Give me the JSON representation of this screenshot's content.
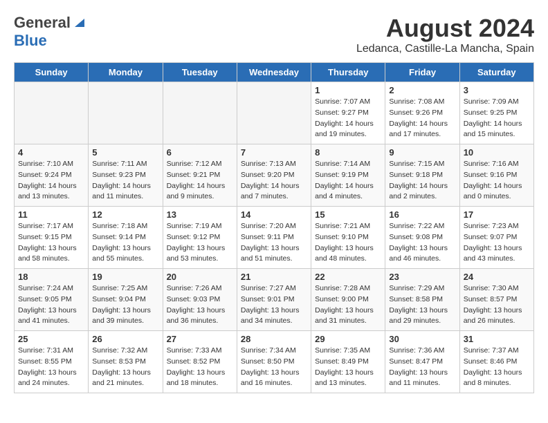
{
  "header": {
    "logo_general": "General",
    "logo_blue": "Blue",
    "month_title": "August 2024",
    "location": "Ledanca, Castille-La Mancha, Spain"
  },
  "days_of_week": [
    "Sunday",
    "Monday",
    "Tuesday",
    "Wednesday",
    "Thursday",
    "Friday",
    "Saturday"
  ],
  "weeks": [
    [
      {
        "day": "",
        "info": ""
      },
      {
        "day": "",
        "info": ""
      },
      {
        "day": "",
        "info": ""
      },
      {
        "day": "",
        "info": ""
      },
      {
        "day": "1",
        "info": "Sunrise: 7:07 AM\nSunset: 9:27 PM\nDaylight: 14 hours\nand 19 minutes."
      },
      {
        "day": "2",
        "info": "Sunrise: 7:08 AM\nSunset: 9:26 PM\nDaylight: 14 hours\nand 17 minutes."
      },
      {
        "day": "3",
        "info": "Sunrise: 7:09 AM\nSunset: 9:25 PM\nDaylight: 14 hours\nand 15 minutes."
      }
    ],
    [
      {
        "day": "4",
        "info": "Sunrise: 7:10 AM\nSunset: 9:24 PM\nDaylight: 14 hours\nand 13 minutes."
      },
      {
        "day": "5",
        "info": "Sunrise: 7:11 AM\nSunset: 9:23 PM\nDaylight: 14 hours\nand 11 minutes."
      },
      {
        "day": "6",
        "info": "Sunrise: 7:12 AM\nSunset: 9:21 PM\nDaylight: 14 hours\nand 9 minutes."
      },
      {
        "day": "7",
        "info": "Sunrise: 7:13 AM\nSunset: 9:20 PM\nDaylight: 14 hours\nand 7 minutes."
      },
      {
        "day": "8",
        "info": "Sunrise: 7:14 AM\nSunset: 9:19 PM\nDaylight: 14 hours\nand 4 minutes."
      },
      {
        "day": "9",
        "info": "Sunrise: 7:15 AM\nSunset: 9:18 PM\nDaylight: 14 hours\nand 2 minutes."
      },
      {
        "day": "10",
        "info": "Sunrise: 7:16 AM\nSunset: 9:16 PM\nDaylight: 14 hours\nand 0 minutes."
      }
    ],
    [
      {
        "day": "11",
        "info": "Sunrise: 7:17 AM\nSunset: 9:15 PM\nDaylight: 13 hours\nand 58 minutes."
      },
      {
        "day": "12",
        "info": "Sunrise: 7:18 AM\nSunset: 9:14 PM\nDaylight: 13 hours\nand 55 minutes."
      },
      {
        "day": "13",
        "info": "Sunrise: 7:19 AM\nSunset: 9:12 PM\nDaylight: 13 hours\nand 53 minutes."
      },
      {
        "day": "14",
        "info": "Sunrise: 7:20 AM\nSunset: 9:11 PM\nDaylight: 13 hours\nand 51 minutes."
      },
      {
        "day": "15",
        "info": "Sunrise: 7:21 AM\nSunset: 9:10 PM\nDaylight: 13 hours\nand 48 minutes."
      },
      {
        "day": "16",
        "info": "Sunrise: 7:22 AM\nSunset: 9:08 PM\nDaylight: 13 hours\nand 46 minutes."
      },
      {
        "day": "17",
        "info": "Sunrise: 7:23 AM\nSunset: 9:07 PM\nDaylight: 13 hours\nand 43 minutes."
      }
    ],
    [
      {
        "day": "18",
        "info": "Sunrise: 7:24 AM\nSunset: 9:05 PM\nDaylight: 13 hours\nand 41 minutes."
      },
      {
        "day": "19",
        "info": "Sunrise: 7:25 AM\nSunset: 9:04 PM\nDaylight: 13 hours\nand 39 minutes."
      },
      {
        "day": "20",
        "info": "Sunrise: 7:26 AM\nSunset: 9:03 PM\nDaylight: 13 hours\nand 36 minutes."
      },
      {
        "day": "21",
        "info": "Sunrise: 7:27 AM\nSunset: 9:01 PM\nDaylight: 13 hours\nand 34 minutes."
      },
      {
        "day": "22",
        "info": "Sunrise: 7:28 AM\nSunset: 9:00 PM\nDaylight: 13 hours\nand 31 minutes."
      },
      {
        "day": "23",
        "info": "Sunrise: 7:29 AM\nSunset: 8:58 PM\nDaylight: 13 hours\nand 29 minutes."
      },
      {
        "day": "24",
        "info": "Sunrise: 7:30 AM\nSunset: 8:57 PM\nDaylight: 13 hours\nand 26 minutes."
      }
    ],
    [
      {
        "day": "25",
        "info": "Sunrise: 7:31 AM\nSunset: 8:55 PM\nDaylight: 13 hours\nand 24 minutes."
      },
      {
        "day": "26",
        "info": "Sunrise: 7:32 AM\nSunset: 8:53 PM\nDaylight: 13 hours\nand 21 minutes."
      },
      {
        "day": "27",
        "info": "Sunrise: 7:33 AM\nSunset: 8:52 PM\nDaylight: 13 hours\nand 18 minutes."
      },
      {
        "day": "28",
        "info": "Sunrise: 7:34 AM\nSunset: 8:50 PM\nDaylight: 13 hours\nand 16 minutes."
      },
      {
        "day": "29",
        "info": "Sunrise: 7:35 AM\nSunset: 8:49 PM\nDaylight: 13 hours\nand 13 minutes."
      },
      {
        "day": "30",
        "info": "Sunrise: 7:36 AM\nSunset: 8:47 PM\nDaylight: 13 hours\nand 11 minutes."
      },
      {
        "day": "31",
        "info": "Sunrise: 7:37 AM\nSunset: 8:46 PM\nDaylight: 13 hours\nand 8 minutes."
      }
    ]
  ]
}
